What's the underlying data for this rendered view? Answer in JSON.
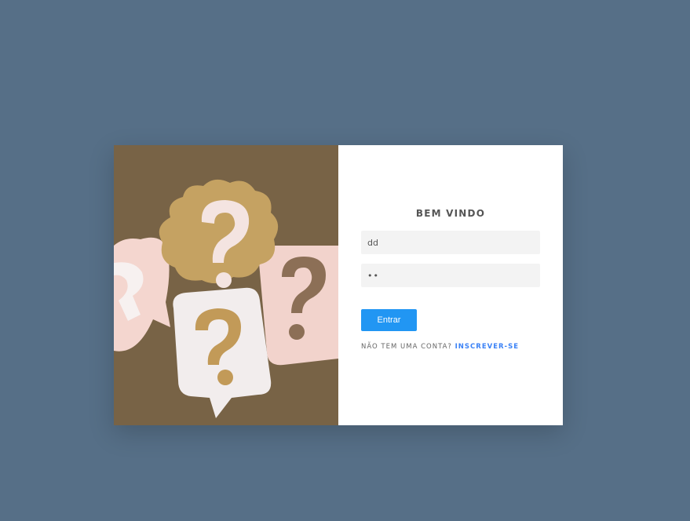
{
  "login": {
    "title": "BEM VINDO",
    "username_value": "dd",
    "password_value": "••",
    "submit_label": "Entrar",
    "no_account_text": "NÃO TEM UMA CONTA? ",
    "signup_link": "INSCREVER-SE"
  },
  "image": {
    "subject": "question-mark-speech-bubbles"
  },
  "colors": {
    "background": "#566f87",
    "card": "#ffffff",
    "input_bg": "#f3f3f3",
    "button": "#2196f3",
    "link": "#3b82f6",
    "title": "#555555"
  }
}
